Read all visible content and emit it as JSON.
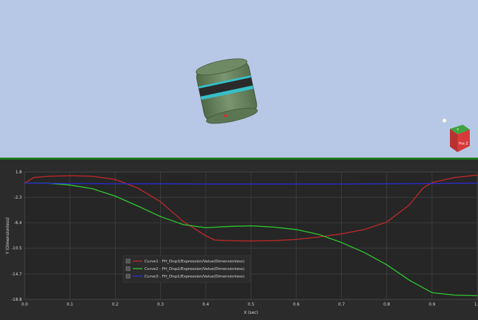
{
  "scene": {
    "background": "#b7c8e6",
    "object": "mechanical-part-3d",
    "orientation_cube": {
      "top_label": "Y",
      "front_label": "Pos Z"
    }
  },
  "chart_data": {
    "type": "line",
    "xlabel": "X (sec)",
    "ylabel": "Y (Dimensionless)",
    "xlim": [
      0,
      1.0
    ],
    "ylim": [
      -18.8,
      1.8
    ],
    "x_ticks": [
      "0.0",
      "0.1",
      "0.2",
      "0.3",
      "0.4",
      "0.5",
      "0.6",
      "0.7",
      "0.8",
      "0.9",
      "1.0"
    ],
    "y_ticks": [
      "1.8",
      "-2.3",
      "-6.4",
      "-10.5",
      "-14.7",
      "-18.8"
    ],
    "grid": true,
    "legend_position": "lower-left",
    "series": [
      {
        "name": "Curve1 : FH_Disp3/Expression/Value(Dimensionless)",
        "color": "#c0282a",
        "x": [
          0,
          0.02,
          0.05,
          0.1,
          0.15,
          0.2,
          0.25,
          0.3,
          0.35,
          0.4,
          0.42,
          0.45,
          0.5,
          0.55,
          0.6,
          0.65,
          0.7,
          0.75,
          0.8,
          0.85,
          0.88,
          0.9,
          0.95,
          1.0
        ],
        "y": [
          0,
          0.9,
          1.1,
          1.2,
          1.1,
          0.6,
          -0.8,
          -3.0,
          -6.2,
          -8.5,
          -9.2,
          -9.3,
          -9.35,
          -9.3,
          -9.1,
          -8.7,
          -8.2,
          -7.5,
          -6.3,
          -3.5,
          -0.8,
          0.1,
          0.9,
          1.3
        ]
      },
      {
        "name": "Curve2 : FH_Disp2/Expression/Value(Dimensionless)",
        "color": "#2fc42f",
        "x": [
          0,
          0.05,
          0.1,
          0.15,
          0.2,
          0.25,
          0.3,
          0.35,
          0.4,
          0.45,
          0.5,
          0.55,
          0.6,
          0.65,
          0.7,
          0.75,
          0.8,
          0.85,
          0.9,
          0.95,
          1.0
        ],
        "y": [
          0,
          0,
          -0.3,
          -0.9,
          -2.1,
          -3.7,
          -5.4,
          -6.7,
          -7.2,
          -7.0,
          -6.9,
          -7.1,
          -7.5,
          -8.3,
          -9.6,
          -11.2,
          -13.2,
          -15.7,
          -17.7,
          -18.1,
          -18.2
        ]
      },
      {
        "name": "Curve3 : FH_Disp1/Expression/Value(Dimensionless)",
        "color": "#2b2bd6",
        "x": [
          0,
          0.1,
          0.2,
          0.3,
          0.4,
          0.5,
          0.6,
          0.7,
          0.8,
          0.9,
          1.0
        ],
        "y": [
          0,
          -0.05,
          -0.1,
          -0.1,
          -0.15,
          -0.15,
          -0.15,
          -0.15,
          -0.1,
          -0.05,
          0
        ]
      }
    ]
  }
}
